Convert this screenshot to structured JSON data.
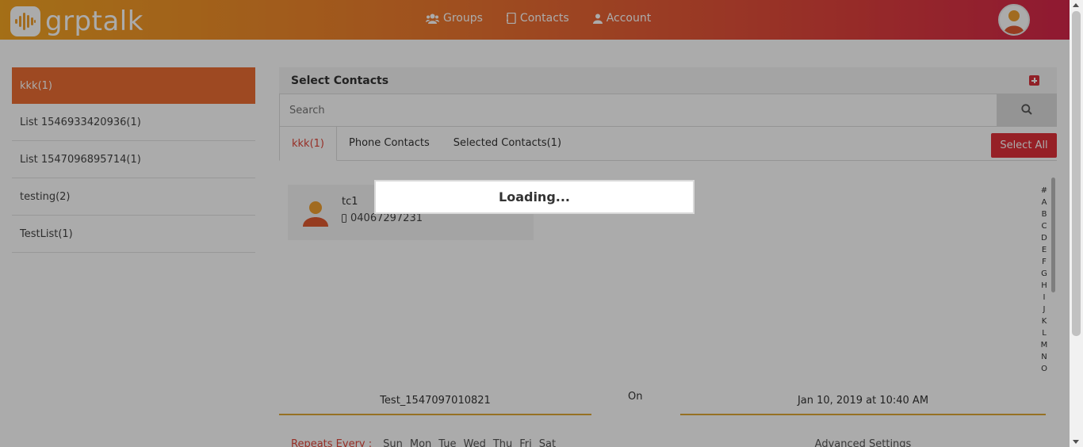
{
  "app": {
    "logo_text": "grptalk"
  },
  "nav": {
    "items": [
      {
        "label": "Groups",
        "icon": "users-icon"
      },
      {
        "label": "Contacts",
        "icon": "address-book-icon"
      },
      {
        "label": "Account",
        "icon": "user-icon"
      }
    ]
  },
  "sidebar": {
    "items": [
      {
        "label": "kkk(1)",
        "active": true
      },
      {
        "label": "List 1546933420936(1)",
        "active": false
      },
      {
        "label": "List 1547096895714(1)",
        "active": false
      },
      {
        "label": "testing(2)",
        "active": false
      },
      {
        "label": "TestList(1)",
        "active": false
      }
    ]
  },
  "panel": {
    "title": "Select Contacts",
    "search_placeholder": "Search",
    "tabs": [
      {
        "label": "kkk(1)",
        "active": true
      },
      {
        "label": "Phone Contacts",
        "active": false
      },
      {
        "label": "Selected Contacts(1)",
        "active": false
      }
    ],
    "select_all_label": "Select All"
  },
  "contacts": [
    {
      "name": "tc1",
      "phone": "04067297231"
    }
  ],
  "alphabet": [
    "#",
    "A",
    "B",
    "C",
    "D",
    "E",
    "F",
    "G",
    "H",
    "I",
    "J",
    "K",
    "L",
    "M",
    "N",
    "O"
  ],
  "schedule": {
    "group_name": "Test_1547097010821",
    "on_label": "On",
    "datetime": "Jan 10, 2019 at 10:40 AM",
    "repeats_label": "Repeats Every :",
    "days": [
      "Sun",
      "Mon",
      "Tue",
      "Wed",
      "Thu",
      "Fri",
      "Sat"
    ],
    "advanced_label": "Advanced Settings"
  },
  "loading": {
    "text": "Loading..."
  },
  "colors": {
    "accent": "#ec6d34",
    "danger": "#e0303a",
    "header_start": "#f5a623",
    "header_end": "#d6264a"
  }
}
